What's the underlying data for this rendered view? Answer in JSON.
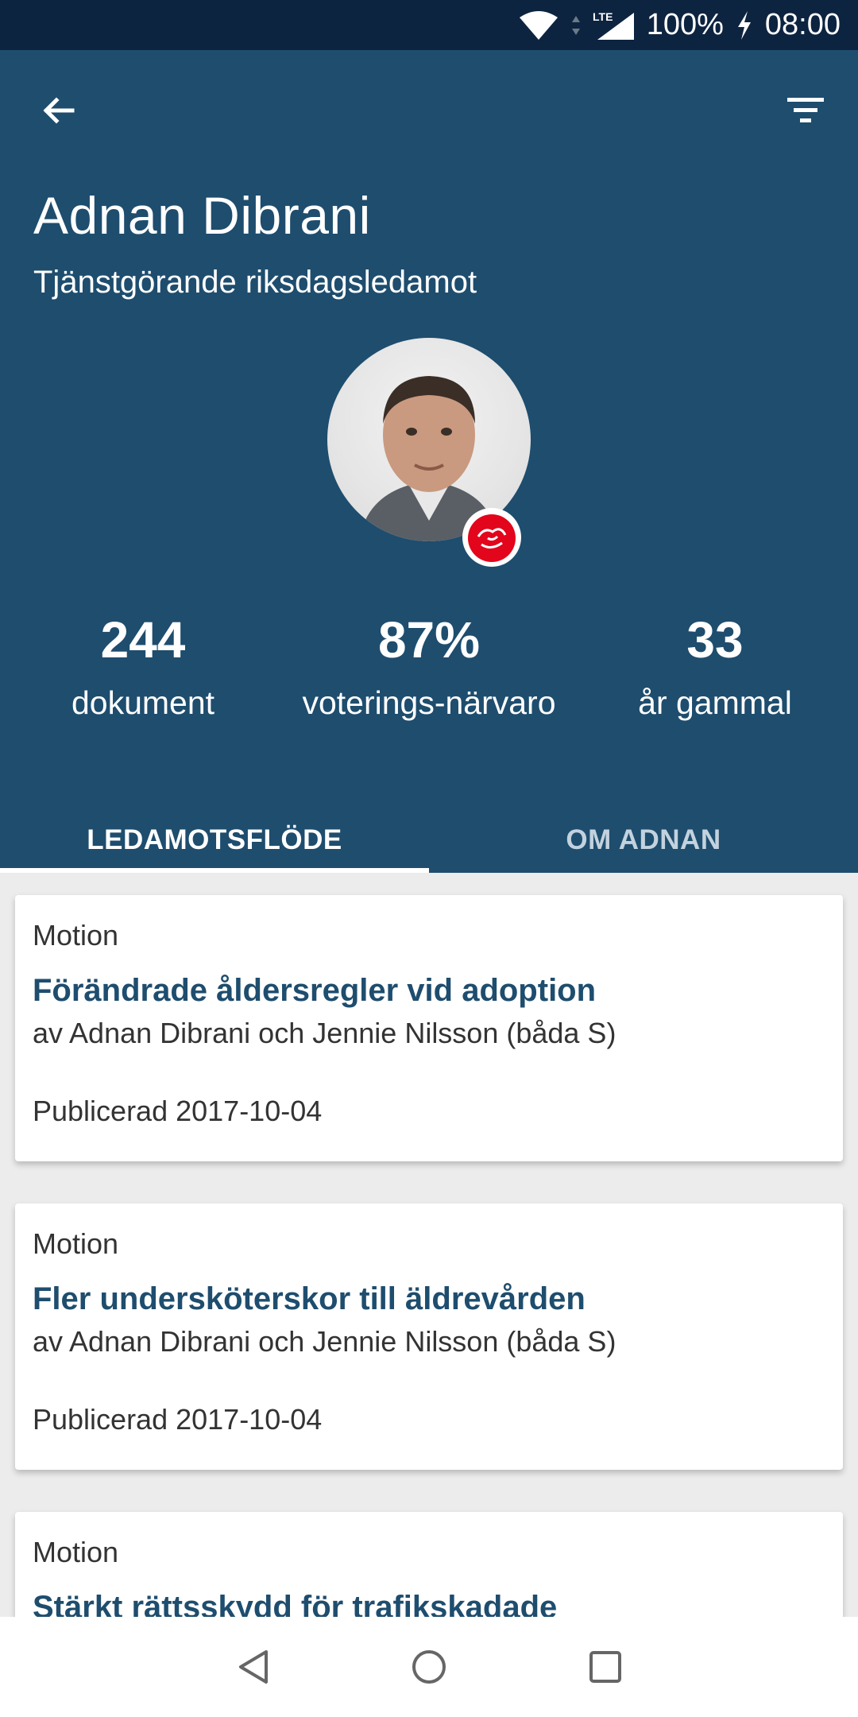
{
  "status_bar": {
    "battery": "100%",
    "time": "08:00",
    "network": "LTE"
  },
  "header": {
    "name": "Adnan Dibrani",
    "role": "Tjänstgörande riksdagsledamot"
  },
  "stats": [
    {
      "value": "244",
      "label": "dokument"
    },
    {
      "value": "87%",
      "label": "voterings-närvaro"
    },
    {
      "value": "33",
      "label": "år gammal"
    }
  ],
  "tabs": [
    {
      "label": "LEDAMOTSFLÖDE",
      "active": true
    },
    {
      "label": "OM ADNAN",
      "active": false
    }
  ],
  "feed": [
    {
      "type": "Motion",
      "title": "Förändrade åldersregler vid adoption",
      "authors": "av Adnan Dibrani och Jennie Nilsson (båda S)",
      "date": "Publicerad 2017-10-04"
    },
    {
      "type": "Motion",
      "title": "Fler undersköterskor till äldrevården",
      "authors": "av Adnan Dibrani och Jennie Nilsson (båda S)",
      "date": "Publicerad 2017-10-04"
    },
    {
      "type": "Motion",
      "title": "Stärkt rättsskydd för trafikskadade",
      "authors": "",
      "date": ""
    }
  ],
  "icons": {
    "back": "arrow-left-icon",
    "filter": "filter-icon",
    "party": "party-rose-icon"
  },
  "colors": {
    "header_bg": "#1e4d6e",
    "status_bg": "#0d2440",
    "title_text": "#1e4d6e",
    "party_red": "#e3051b"
  }
}
